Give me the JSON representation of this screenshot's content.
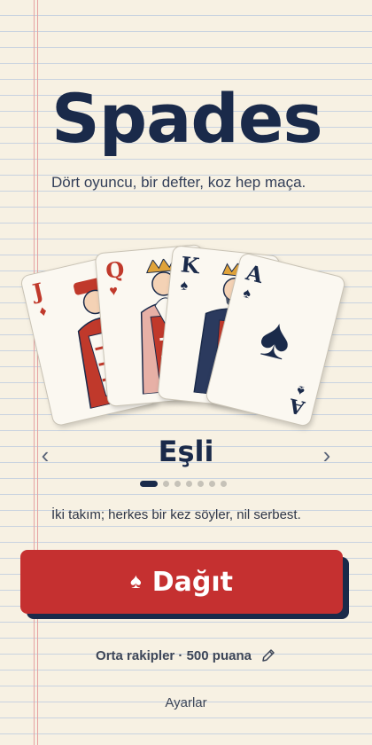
{
  "app": {
    "title": "Spades",
    "tagline": "Dört oyuncu, bir defter, koz hep maça."
  },
  "cards": [
    {
      "rank": "J",
      "suit": "♦",
      "suit_name": "diamonds",
      "color": "#c0392b"
    },
    {
      "rank": "Q",
      "suit": "♥",
      "suit_name": "hearts",
      "color": "#c0392b"
    },
    {
      "rank": "K",
      "suit": "♠",
      "suit_name": "spades",
      "color": "#1a2a4a"
    },
    {
      "rank": "A",
      "suit": "♠",
      "suit_name": "spades",
      "color": "#1a2a4a"
    }
  ],
  "mode": {
    "label": "Eşli",
    "prev_icon": "chevron-left-icon",
    "next_icon": "chevron-right-icon",
    "page_count": 7,
    "active_page": 1,
    "description": "İki takım; herkes bir kez söyler, nil serbest."
  },
  "deal_button": {
    "label": "Dağıt",
    "icon": "♠"
  },
  "settings_summary": "Orta rakipler · 500 puana",
  "settings_link": "Ayarlar",
  "colors": {
    "navy": "#1a2a4a",
    "red": "#c53030",
    "paper": "#f7f1e3"
  }
}
